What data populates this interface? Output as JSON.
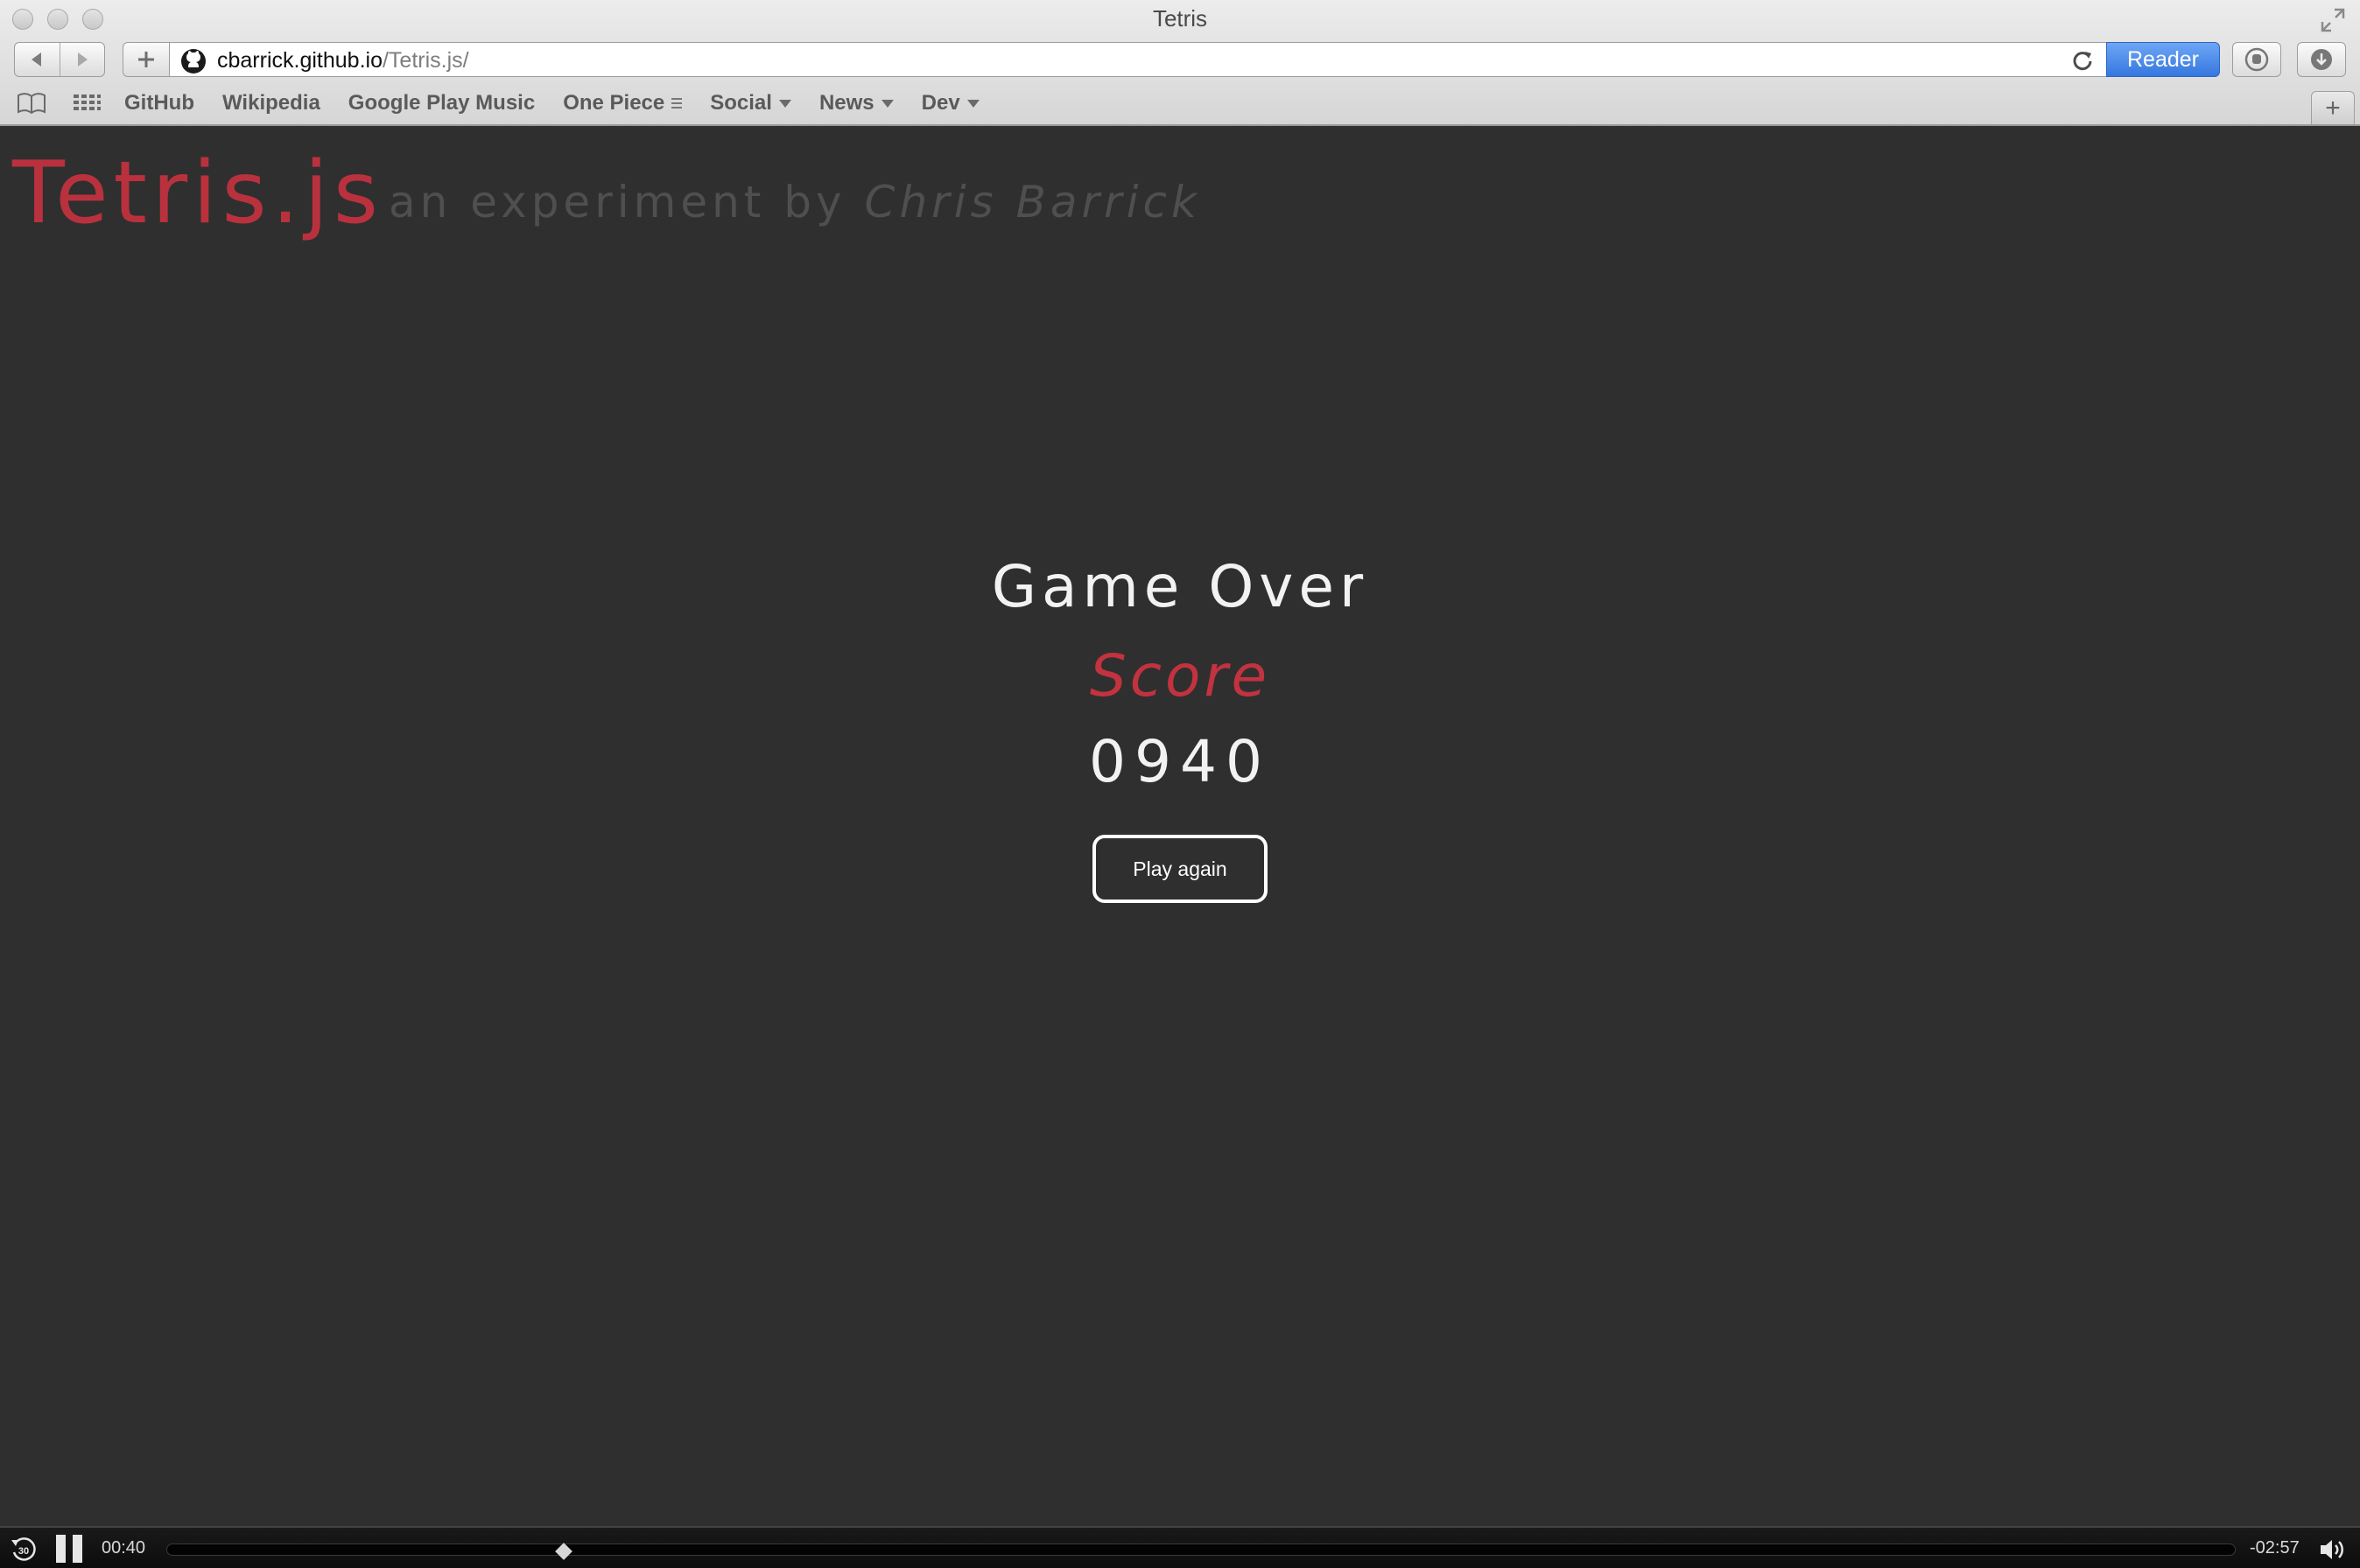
{
  "window": {
    "title": "Tetris"
  },
  "address_bar": {
    "domain": "cbarrick.github.io",
    "path": "/Tetris.js/"
  },
  "toolbar": {
    "reader_label": "Reader"
  },
  "bookmarks": [
    {
      "label": "GitHub",
      "kind": "link"
    },
    {
      "label": "Wikipedia",
      "kind": "link"
    },
    {
      "label": "Google Play Music",
      "kind": "link"
    },
    {
      "label": "One Piece",
      "kind": "folder"
    },
    {
      "label": "Social",
      "kind": "menu"
    },
    {
      "label": "News",
      "kind": "menu"
    },
    {
      "label": "Dev",
      "kind": "menu"
    }
  ],
  "page": {
    "logo": "Tetris.js",
    "subtitle_prefix": "an experiment by ",
    "author": "Chris Barrick",
    "game_over": "Game Over",
    "score_label": "Score",
    "score_value": "0940",
    "play_again_label": "Play again"
  },
  "media": {
    "elapsed": "00:40",
    "remaining": "-02:57",
    "progress": 0.19
  },
  "colors": {
    "accent_red": "#c2323f",
    "page_bg": "#2f2f2f",
    "reader_blue": "#3577e0"
  }
}
